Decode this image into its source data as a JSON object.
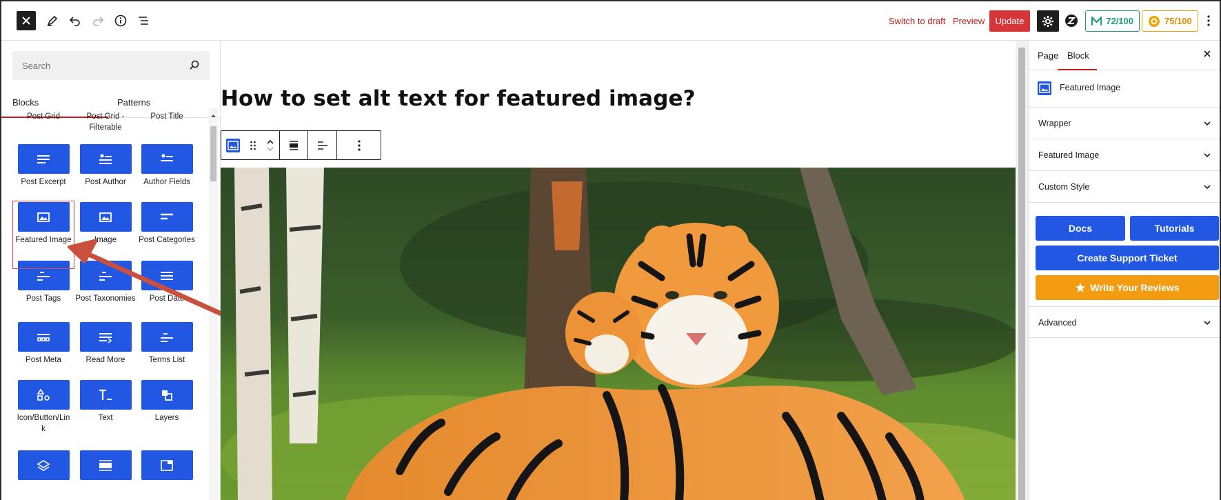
{
  "topbar": {
    "switch_draft": "Switch to draft",
    "preview": "Preview",
    "update": "Update",
    "score_green": "72/100",
    "score_orange": "75/100"
  },
  "inserter": {
    "search_placeholder": "Search",
    "tabs": [
      "Blocks",
      "Patterns"
    ],
    "row0": [
      "Post Grid",
      "Post Grid - Filterable",
      "Post Title"
    ],
    "blocks": [
      {
        "label": "Post Excerpt",
        "icon": "excerpt-icon"
      },
      {
        "label": "Post Author",
        "icon": "author-icon"
      },
      {
        "label": "Author Fields",
        "icon": "author-fields-icon"
      },
      {
        "label": "Featured Image",
        "icon": "featured-image-icon"
      },
      {
        "label": "Image",
        "icon": "image-icon"
      },
      {
        "label": "Post Categories",
        "icon": "categories-icon"
      },
      {
        "label": "Post Tags",
        "icon": "tags-icon"
      },
      {
        "label": "Post Taxonomies",
        "icon": "taxonomies-icon"
      },
      {
        "label": "Post Date",
        "icon": "date-icon"
      },
      {
        "label": "Post Meta",
        "icon": "meta-icon"
      },
      {
        "label": "Read More",
        "icon": "read-more-icon"
      },
      {
        "label": "Terms List",
        "icon": "terms-list-icon"
      },
      {
        "label": "Icon/Button/Link",
        "icon": "shapes-icon"
      },
      {
        "label": "Text",
        "icon": "text-icon"
      },
      {
        "label": "Layers",
        "icon": "layers-icon"
      }
    ]
  },
  "canvas": {
    "title": "How to set alt text for featured image?"
  },
  "sidebar": {
    "tabs": [
      "Page",
      "Block"
    ],
    "block_name": "Featured Image",
    "panels": [
      "Wrapper",
      "Featured Image",
      "Custom Style"
    ],
    "docs": "Docs",
    "tutorials": "Tutorials",
    "support": "Create Support Ticket",
    "reviews": "Write Your Reviews",
    "advanced": "Advanced"
  },
  "colors": {
    "accent_blue": "#2157e3",
    "update_red": "#d63638",
    "highlight_red": "#e04444",
    "review_orange": "#f39c12"
  }
}
